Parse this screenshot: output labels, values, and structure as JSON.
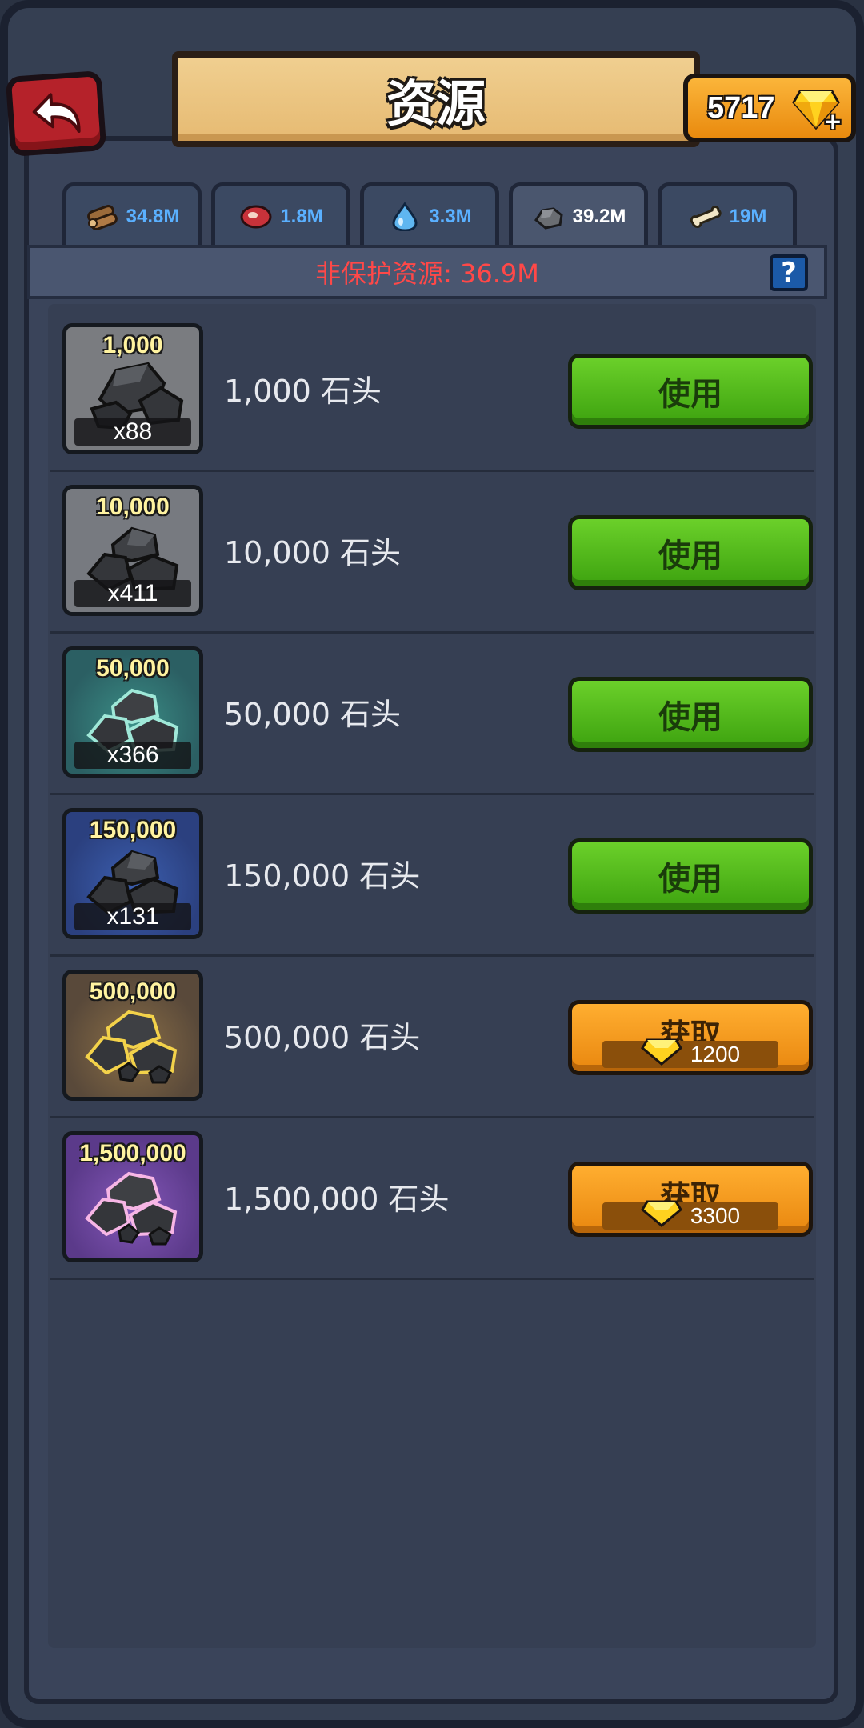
{
  "header": {
    "title": "资源",
    "gems": "5717"
  },
  "tabs": [
    {
      "icon": "wood-log-icon",
      "amount": "34.8M",
      "active": false
    },
    {
      "icon": "meat-icon",
      "amount": "1.8M",
      "active": false
    },
    {
      "icon": "water-drop-icon",
      "amount": "3.3M",
      "active": false
    },
    {
      "icon": "stone-icon",
      "amount": "39.2M",
      "active": true
    },
    {
      "icon": "bone-icon",
      "amount": "19M",
      "active": false
    }
  ],
  "info": {
    "unprotected_label": "非保护资源: 36.9M",
    "help": "?"
  },
  "items": [
    {
      "top_qty": "1,000",
      "count": "x88",
      "name": "1,000 石头",
      "action": "使用"
    },
    {
      "top_qty": "10,000",
      "count": "x411",
      "name": "10,000 石头",
      "action": "使用"
    },
    {
      "top_qty": "50,000",
      "count": "x366",
      "name": "50,000 石头",
      "action": "使用"
    },
    {
      "top_qty": "150,000",
      "count": "x131",
      "name": "150,000 石头",
      "action": "使用"
    },
    {
      "top_qty": "500,000",
      "name": "500,000 石头",
      "action": "获取",
      "price": "1200"
    },
    {
      "top_qty": "1,500,000",
      "name": "1,500,000 石头",
      "action": "获取",
      "price": "3300"
    }
  ],
  "colors": {
    "warning_red": "#ff4848",
    "tab_amount_blue": "#5ab0ff",
    "use_green": "#4db81a",
    "get_orange": "#f59a1c"
  }
}
